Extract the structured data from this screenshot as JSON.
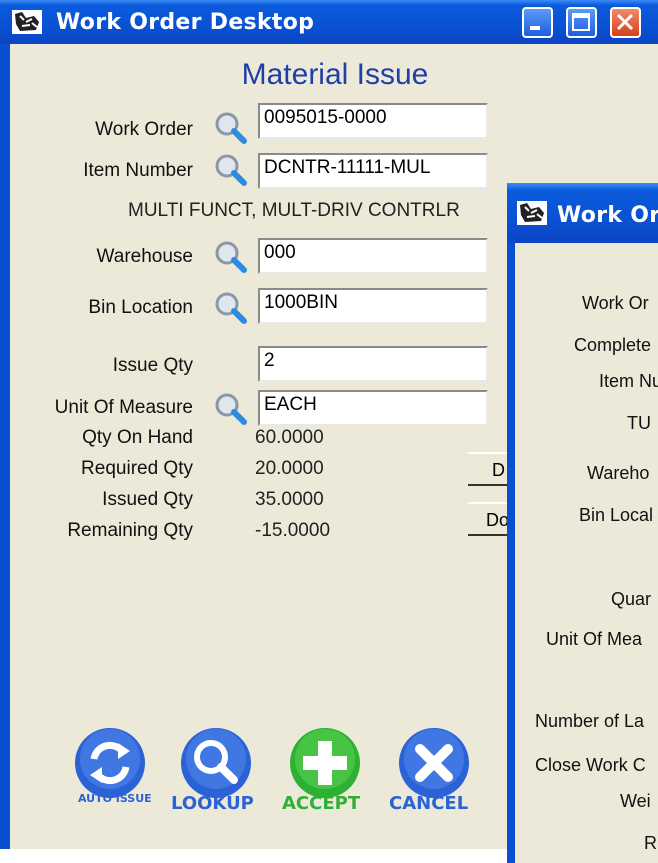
{
  "main_window": {
    "title": "Work Order Desktop",
    "heading": "Material Issue",
    "fields": {
      "work_order": {
        "label": "Work Order",
        "value": "0095015-0000"
      },
      "item_number": {
        "label": "Item Number",
        "value": "DCNTR-11111-MUL"
      },
      "item_description": "MULTI FUNCT, MULT-DRIV CONTRLR",
      "warehouse": {
        "label": "Warehouse",
        "value": "000"
      },
      "bin_location": {
        "label": "Bin Location",
        "value": "1000BIN"
      },
      "issue_qty": {
        "label": "Issue Qty",
        "value": "2"
      },
      "unit_of_measure": {
        "label": "Unit Of Measure",
        "value": "EACH"
      }
    },
    "stats": {
      "qty_on_hand": {
        "label": "Qty On Hand",
        "value": "60.0000"
      },
      "required_qty": {
        "label": "Required Qty",
        "value": "20.0000"
      },
      "issued_qty": {
        "label": "Issued Qty",
        "value": "35.0000"
      },
      "remaining_qty": {
        "label": "Remaining Qty",
        "value": "-15.0000"
      }
    },
    "side_buttons": [
      "D",
      "Do"
    ],
    "actions": {
      "auto_issue": "AUTO ISSUE",
      "lookup": "LOOKUP",
      "accept": "ACCEPT",
      "cancel": "CANCEL"
    },
    "colors": {
      "accept": "#2db034",
      "blue_btn": "#2b63d6",
      "heading": "#1f3fa8"
    }
  },
  "second_window": {
    "title": "Work Or",
    "labels": [
      "Work Or",
      "Complete",
      "Item Num",
      "TU",
      "Wareho",
      "Bin Local",
      "Quar",
      "Unit Of Mea",
      "Number of La",
      "Close Work C",
      "Wei",
      "R"
    ]
  }
}
